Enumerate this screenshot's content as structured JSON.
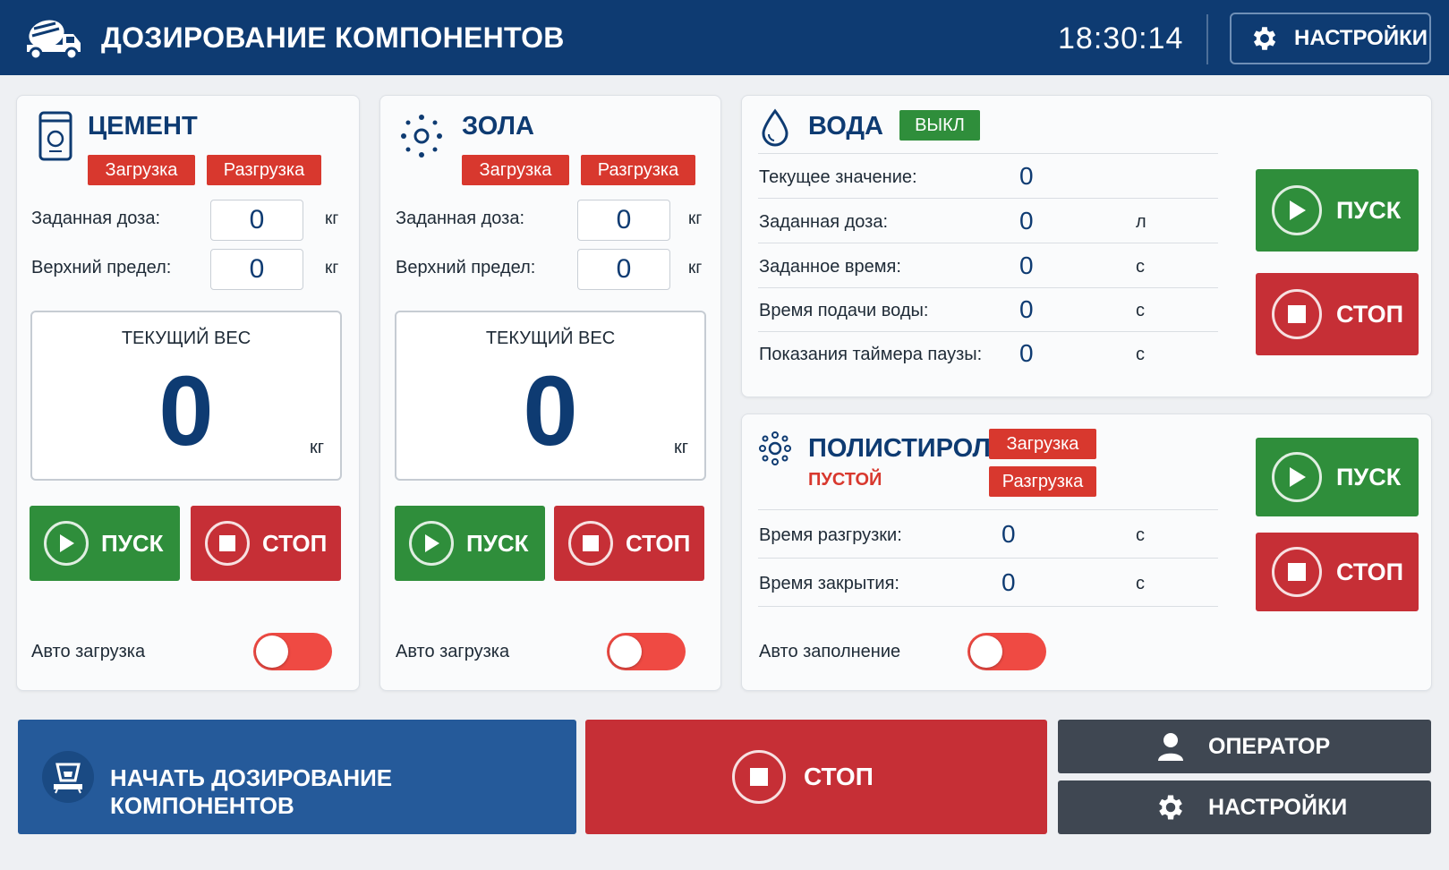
{
  "header": {
    "title": "ДОЗИРОВАНИЕ КОМПОНЕНТОВ",
    "time": "18:30:14",
    "settings_label": "НАСТРОЙКИ"
  },
  "cement": {
    "title": "ЦЕМЕНТ",
    "load_label": "Загрузка",
    "unload_label": "Разгрузка",
    "dose_label": "Заданная доза:",
    "dose_value": "0",
    "dose_unit": "кг",
    "limit_label": "Верхний предел:",
    "limit_value": "0",
    "limit_unit": "кг",
    "weight_label": "ТЕКУЩИЙ ВЕС",
    "weight_value": "0",
    "weight_unit": "кг",
    "start_label": "ПУСК",
    "stop_label": "СТОП",
    "auto_label": "Авто загрузка",
    "auto_on": false
  },
  "ash": {
    "title": "ЗОЛА",
    "load_label": "Загрузка",
    "unload_label": "Разгрузка",
    "dose_label": "Заданная доза:",
    "dose_value": "0",
    "dose_unit": "кг",
    "limit_label": "Верхний предел:",
    "limit_value": "0",
    "limit_unit": "кг",
    "weight_label": "ТЕКУЩИЙ ВЕС",
    "weight_value": "0",
    "weight_unit": "кг",
    "start_label": "ПУСК",
    "stop_label": "СТОП",
    "auto_label": "Авто загрузка",
    "auto_on": false
  },
  "water": {
    "title": "ВОДА",
    "status": "ВЫКЛ",
    "rows": [
      {
        "label": "Текущее значение:",
        "value": "0",
        "unit": ""
      },
      {
        "label": "Заданная доза:",
        "value": "0",
        "unit": "л"
      },
      {
        "label": "Заданное время:",
        "value": "0",
        "unit": "с"
      },
      {
        "label": "Время подачи воды:",
        "value": "0",
        "unit": "с"
      },
      {
        "label": "Показания таймера паузы:",
        "value": "0",
        "unit": "с"
      }
    ],
    "start_label": "ПУСК",
    "stop_label": "СТОП"
  },
  "polystyrene": {
    "title": "ПОЛИСТИРОЛ",
    "state": "ПУСТОЙ",
    "load_label": "Загрузка",
    "unload_label": "Разгрузка",
    "rows": [
      {
        "label": "Время разгрузки:",
        "value": "0",
        "unit": "с"
      },
      {
        "label": "Время закрытия:",
        "value": "0",
        "unit": "с"
      }
    ],
    "auto_label": "Авто заполнение",
    "auto_on": false,
    "start_label": "ПУСК",
    "stop_label": "СТОП"
  },
  "bottom": {
    "start_label": "НАЧАТЬ ДОЗИРОВАНИЕ КОМПОНЕНТОВ",
    "stop_label": "СТОП",
    "operator_label": "ОПЕРАТОР",
    "settings_label": "НАСТРОЙКИ"
  },
  "colors": {
    "header_bg": "#0e3b72",
    "go": "#2f8e3b",
    "stop": "#c62f36",
    "tag_red": "#d8382e",
    "toggle_off": "#ef4a43",
    "primary_blue": "#255a9a",
    "dark_button": "#3f4752"
  }
}
